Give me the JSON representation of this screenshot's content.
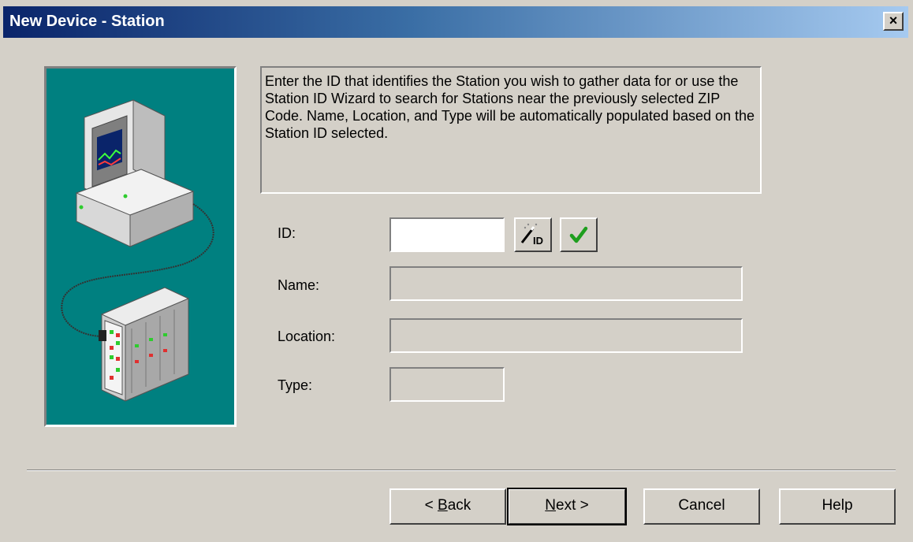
{
  "window": {
    "title": "New Device - Station",
    "close_label": "×"
  },
  "info": {
    "text": "Enter the ID that identifies the Station you wish to gather data for or use the Station ID Wizard to search for Stations near the previously selected ZIP Code.  Name, Location, and Type will be automatically populated based on the Station ID selected."
  },
  "form": {
    "id_label": "ID:",
    "id_value": "",
    "name_label": "Name:",
    "name_value": "",
    "location_label": "Location:",
    "location_value": "",
    "type_label": "Type:",
    "type_value": "",
    "wizard_icon_text": "ID"
  },
  "buttons": {
    "back_prefix": "< ",
    "back_underlined": "B",
    "back_rest": "ack",
    "next_underlined": "N",
    "next_rest": "ext >",
    "cancel": "Cancel",
    "help": "Help"
  },
  "icons": {
    "wizard": "magic-wand-id-icon",
    "check": "green-checkmark-icon",
    "illustration": "computer-and-device-icon"
  },
  "colors": {
    "title_start": "#0a246a",
    "title_end": "#a6caf0",
    "illustration_bg": "#008080",
    "check_green": "#1e9e1e"
  }
}
